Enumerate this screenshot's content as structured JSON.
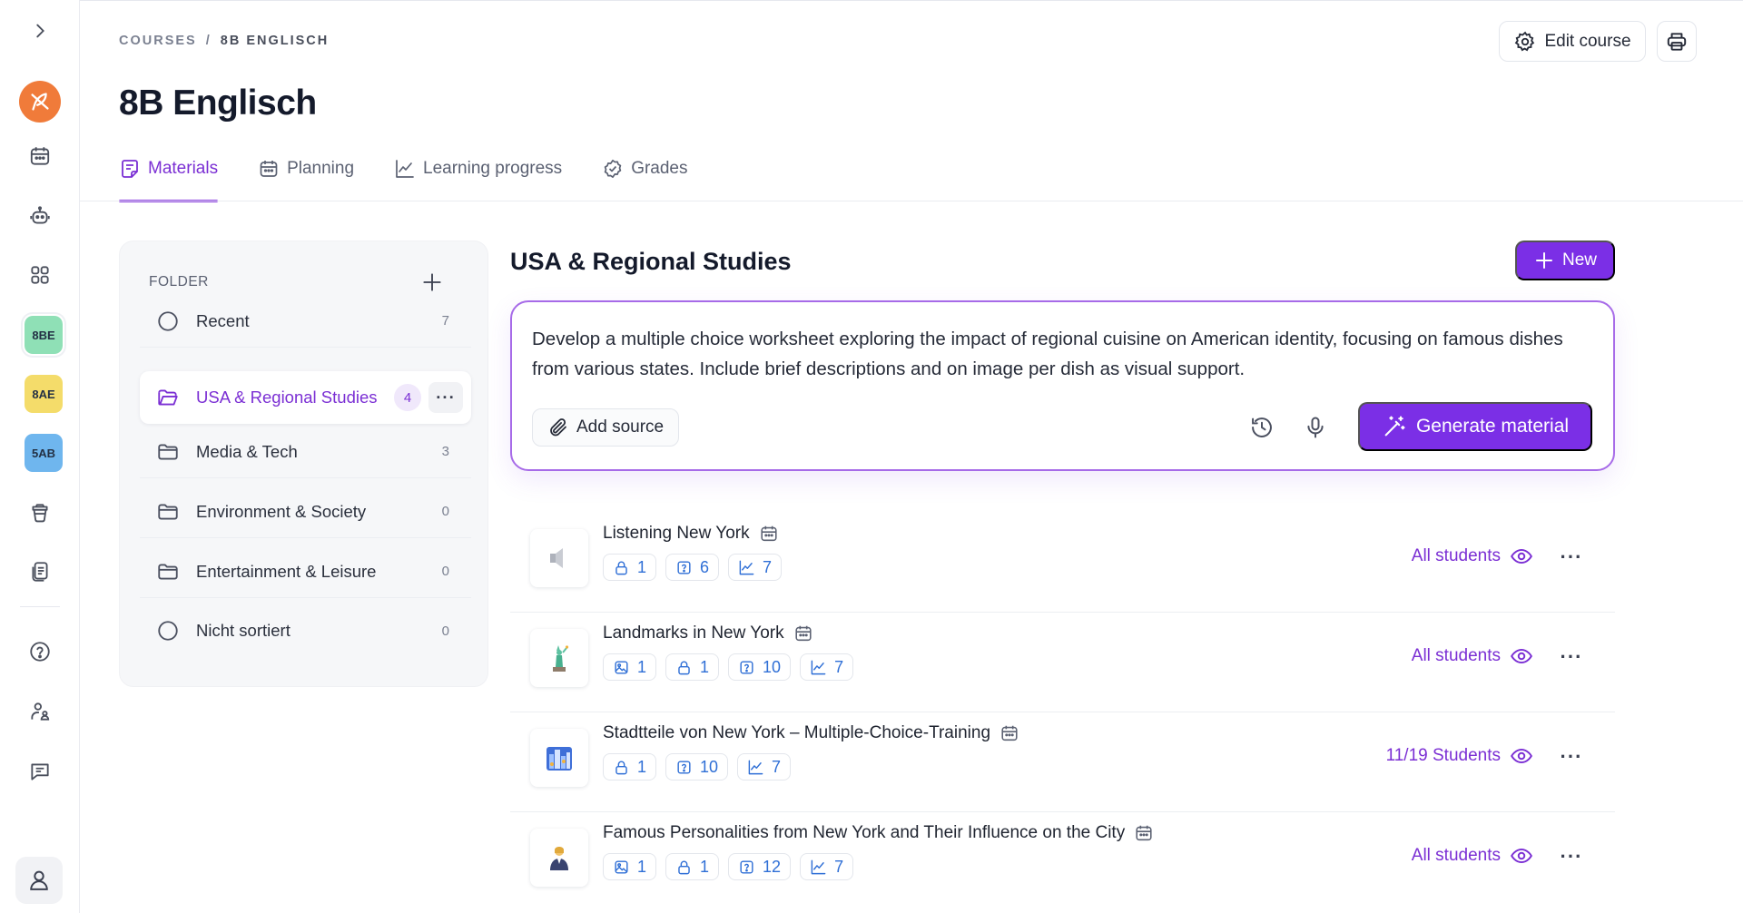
{
  "breadcrumb": {
    "root": "COURSES",
    "separator": "/",
    "current": "8B ENGLISCH"
  },
  "page_title": "8B Englisch",
  "header": {
    "edit_course_label": "Edit course"
  },
  "rail": {
    "badges": [
      {
        "label": "8BE",
        "color": "#8fe0b6"
      },
      {
        "label": "8AE",
        "color": "#f4dc6a"
      },
      {
        "label": "5AB",
        "color": "#6fb6ee"
      }
    ]
  },
  "tabs": [
    {
      "label": "Materials",
      "active": true
    },
    {
      "label": "Planning",
      "active": false
    },
    {
      "label": "Learning progress",
      "active": false
    },
    {
      "label": "Grades",
      "active": false
    }
  ],
  "folders": {
    "heading": "FOLDER",
    "items": [
      {
        "label": "Recent",
        "count": "7"
      },
      {
        "label": "USA & Regional Studies",
        "count": "4"
      },
      {
        "label": "Media & Tech",
        "count": "3"
      },
      {
        "label": "Environment & Society",
        "count": "0"
      },
      {
        "label": "Entertainment & Leisure",
        "count": "0"
      },
      {
        "label": "Nicht sortiert",
        "count": "0"
      }
    ]
  },
  "main": {
    "section_title": "USA & Regional Studies",
    "new_label": "New",
    "prompt_text": "Develop a multiple choice worksheet exploring the impact of regional cuisine on American identity, focusing on famous dishes from various states. Include brief descriptions and on image per dish as visual support.",
    "add_source_label": "Add source",
    "generate_label": "Generate material"
  },
  "materials": [
    {
      "title": "Listening New York",
      "thumb": "speaker-icon",
      "chips": [
        {
          "icon": "lock-icon",
          "value": "1"
        },
        {
          "icon": "question-icon",
          "value": "6"
        },
        {
          "icon": "chart-icon",
          "value": "7"
        }
      ],
      "audience": "All students"
    },
    {
      "title": "Landmarks in New York",
      "thumb": "statue-of-liberty-icon",
      "chips": [
        {
          "icon": "image-icon",
          "value": "1"
        },
        {
          "icon": "lock-icon",
          "value": "1"
        },
        {
          "icon": "question-icon",
          "value": "10"
        },
        {
          "icon": "chart-icon",
          "value": "7"
        }
      ],
      "audience": "All students"
    },
    {
      "title": "Stadtteile von New York – Multiple-Choice-Training",
      "thumb": "cityscape-icon",
      "chips": [
        {
          "icon": "lock-icon",
          "value": "1"
        },
        {
          "icon": "question-icon",
          "value": "10"
        },
        {
          "icon": "chart-icon",
          "value": "7"
        }
      ],
      "audience": "11/19 Students"
    },
    {
      "title": "Famous Personalities from New York and Their Influence on the City",
      "thumb": "person-icon",
      "chips": [
        {
          "icon": "image-icon",
          "value": "1"
        },
        {
          "icon": "lock-icon",
          "value": "1"
        },
        {
          "icon": "question-icon",
          "value": "12"
        },
        {
          "icon": "chart-icon",
          "value": "7"
        }
      ],
      "audience": "All students"
    }
  ]
}
